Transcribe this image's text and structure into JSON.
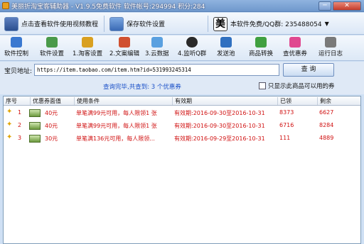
{
  "window": {
    "title": "美丽折淘宝客辅助器 - V1.9.5免费软件  软件帐号:294994 积分:284",
    "minimize": "─",
    "close": "✕"
  },
  "toolbar_top": {
    "video_tutorial": "点击查看软件使用视频教程",
    "save_settings": "保存软件设置",
    "qq_icon": "美",
    "account": "本软件免费/QQ群: 235488054",
    "caret": "▼"
  },
  "tools": [
    {
      "label": "软件控制",
      "icon": "control-icon",
      "color": "#3a78d0"
    },
    {
      "label": "软件设置",
      "icon": "settings-icon",
      "color": "#4a9a4a"
    },
    {
      "label": "1.淘客设置",
      "icon": "taoke-icon",
      "color": "#d9a020"
    },
    {
      "label": "2.文案编辑",
      "icon": "edit-icon",
      "color": "#d05030"
    },
    {
      "label": "3.云数据",
      "icon": "cloud-icon",
      "color": "#5aa0e0"
    },
    {
      "label": "4.监听Q群",
      "icon": "qq-group-icon",
      "color": "#2a2a2a"
    },
    {
      "label": "发送池",
      "icon": "send-icon",
      "color": "#3070c0"
    },
    {
      "label": "商品转换",
      "icon": "convert-icon",
      "color": "#40a040"
    },
    {
      "label": "查优惠券",
      "icon": "coupon-icon",
      "color": "#e04890"
    },
    {
      "label": "运行日志",
      "icon": "log-icon",
      "color": "#7a7a7a"
    }
  ],
  "url": {
    "label": "宝贝地址:",
    "value": "https://item.taobao.com/item.htm?id=531993245314",
    "query_button": "查 询"
  },
  "status": {
    "message": "查询完毕,共查到: 3 个优惠券",
    "only_show_label": "只显示此商品可以用的券"
  },
  "table": {
    "headers": [
      "序号",
      "优惠券面值",
      "使用条件",
      "有效期",
      "已领",
      "剩余"
    ],
    "rows": [
      {
        "index": "1",
        "value": "40元",
        "condition": "单笔满99元可用，每人限领1 张",
        "validity": "有效期:2016-09-30至2016-10-31",
        "claimed": "8373",
        "remaining": "6627"
      },
      {
        "index": "2",
        "value": "40元",
        "condition": "单笔满99元可用，每人限领1 张",
        "validity": "有效期:2016-09-30至2016-10-31",
        "claimed": "6716",
        "remaining": "8284"
      },
      {
        "index": "3",
        "value": "30元",
        "condition": "单笔满136元可用，每人限领...",
        "validity": "有效期:2016-09-29至2016-10-31",
        "claimed": "111",
        "remaining": "4889"
      }
    ]
  }
}
